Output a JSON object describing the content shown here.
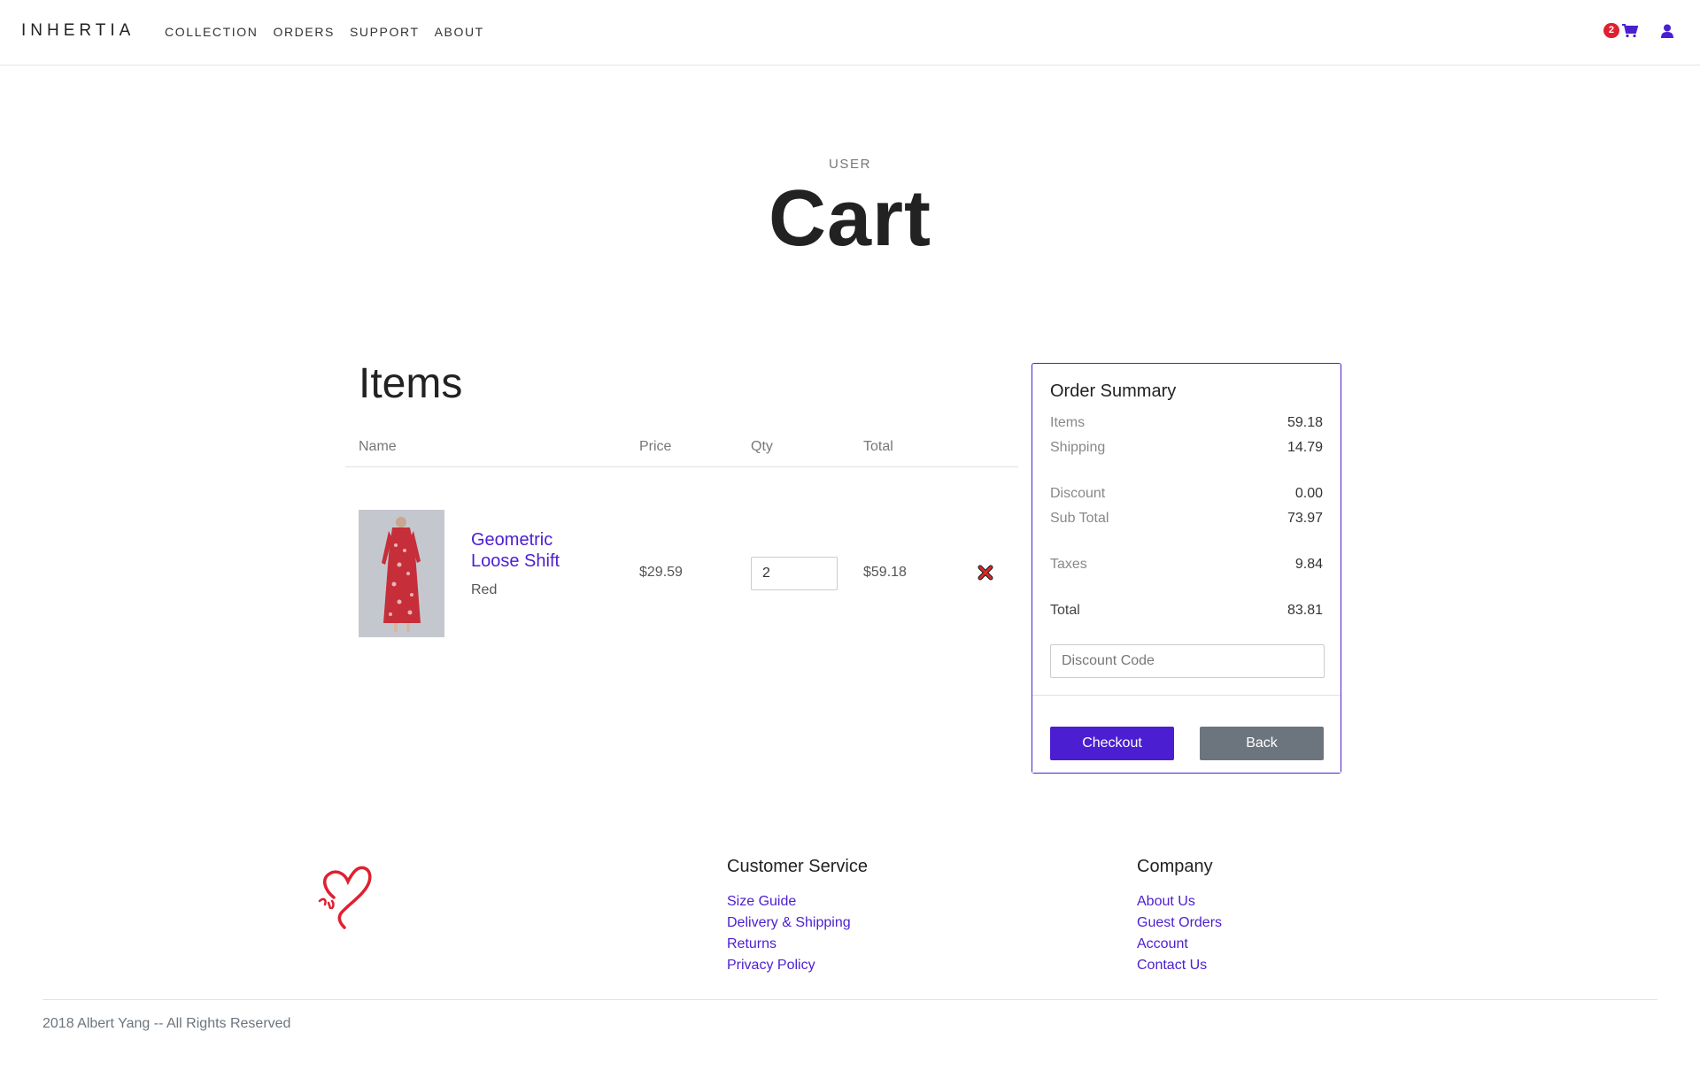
{
  "header": {
    "brand": "INHERTIA",
    "nav": [
      "COLLECTION",
      "ORDERS",
      "SUPPORT",
      "ABOUT"
    ],
    "cart_count": "2",
    "icons": [
      "cart-icon",
      "user-icon"
    ],
    "accent_color": "#4b1ed1",
    "badge_color": "#e0202f"
  },
  "page": {
    "eyebrow": "USER",
    "title": "Cart"
  },
  "items_section": {
    "heading": "Items",
    "columns": [
      "Name",
      "Price",
      "Qty",
      "Total"
    ],
    "rows": [
      {
        "name": "Geometric Loose Shift",
        "color": "Red",
        "price": "$29.59",
        "qty": "2",
        "total": "$59.18",
        "remove_icon": "remove-x-icon"
      }
    ]
  },
  "summary": {
    "title": "Order Summary",
    "items_label": "Items",
    "items_value": "59.18",
    "shipping_label": "Shipping",
    "shipping_value": "14.79",
    "discount_label": "Discount",
    "discount_value": "0.00",
    "subtotal_label": "Sub Total",
    "subtotal_value": "73.97",
    "taxes_label": "Taxes",
    "taxes_value": "9.84",
    "total_label": "Total",
    "total_value": "83.81",
    "discount_placeholder": "Discount Code",
    "checkout_label": "Checkout",
    "back_label": "Back"
  },
  "footer": {
    "logo_icon": "heart-logo-icon",
    "customer_service": {
      "title": "Customer Service",
      "links": [
        "Size Guide",
        "Delivery & Shipping",
        "Returns",
        "Privacy Policy"
      ]
    },
    "company": {
      "title": "Company",
      "links": [
        "About Us",
        "Guest Orders",
        "Account",
        "Contact Us"
      ]
    },
    "copyright": "2018 Albert Yang -- All Rights Reserved"
  }
}
